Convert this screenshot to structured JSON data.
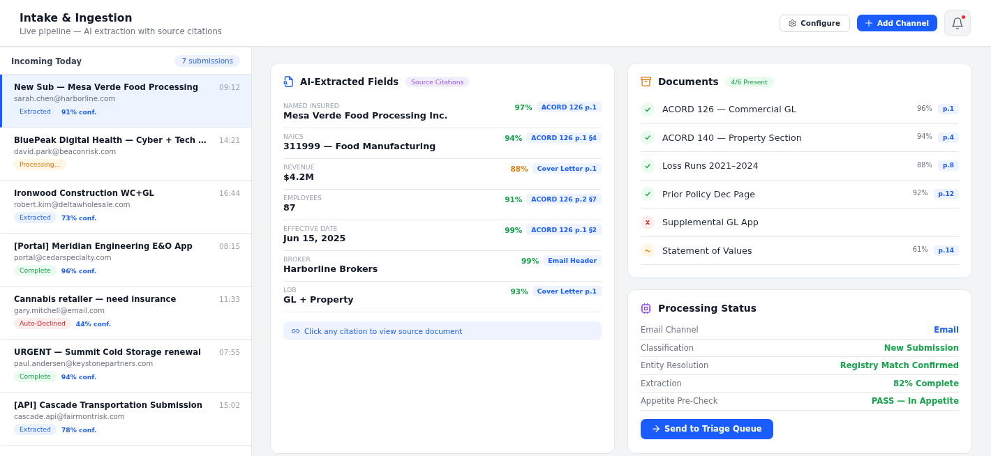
{
  "header": {
    "title": "Intake & Ingestion",
    "subtitle": "Live pipeline — AI extraction with source citations",
    "actions": [
      {
        "kind": "settings",
        "label": "Configure"
      },
      {
        "kind": "add",
        "label": "Add Channel"
      }
    ],
    "notifications": {
      "unread": true
    }
  },
  "inbox": {
    "title": "Incoming Today",
    "count": "7 submissions",
    "items": [
      {
        "title": "New Sub — Mesa Verde Food Processing",
        "time": "09:12",
        "email": "sarah.chen@harborline.com",
        "status": {
          "kind": "extracted",
          "label": "Extracted"
        },
        "confidence": "91% conf.",
        "selected": true
      },
      {
        "title": "BluePeak Digital Health — Cyber + Tech …",
        "time": "14:21",
        "email": "david.park@beaconrisk.com",
        "status": {
          "kind": "processing",
          "label": "Processing..."
        },
        "selected": false
      },
      {
        "title": "Ironwood Construction WC+GL",
        "time": "16:44",
        "email": "robert.kim@deltawholesale.com",
        "status": {
          "kind": "extracted",
          "label": "Extracted"
        },
        "confidence": "73% conf.",
        "selected": false
      },
      {
        "title": "[Portal] Meridian Engineering E&O App",
        "time": "08:15",
        "email": "portal@cedarspecialty.com",
        "status": {
          "kind": "complete",
          "label": "Complete"
        },
        "confidence": "96% conf.",
        "selected": false
      },
      {
        "title": "Cannabis retailer — need insurance",
        "time": "11:33",
        "email": "gary.mitchell@email.com",
        "status": {
          "kind": "declined",
          "label": "Auto-Declined"
        },
        "confidence": "44% conf.",
        "selected": false
      },
      {
        "title": "URGENT — Summit Cold Storage renewal",
        "time": "07:55",
        "email": "paul.andersen@keystonepartners.com",
        "status": {
          "kind": "complete",
          "label": "Complete"
        },
        "confidence": "94% conf.",
        "selected": false
      },
      {
        "title": "[API] Cascade Transportation Submission",
        "time": "15:02",
        "email": "cascade.api@fairmontrisk.com",
        "status": {
          "kind": "extracted",
          "label": "Extracted"
        },
        "confidence": "78% conf.",
        "selected": false
      }
    ]
  },
  "fields_card": {
    "title": "AI-Extracted Fields",
    "badge": "Source Citations",
    "fields": [
      {
        "label": "NAMED INSURED",
        "value": "Mesa Verde Food Processing Inc.",
        "confidence": "97%",
        "color": "#16a34a",
        "citation": "ACORD 126 p.1"
      },
      {
        "label": "NAICS",
        "value": "311999 — Food Manufacturing",
        "confidence": "94%",
        "color": "#16a34a",
        "citation": "ACORD 126 p.1 §4"
      },
      {
        "label": "REVENUE",
        "value": "$4.2M",
        "confidence": "88%",
        "color": "#e07a10",
        "citation": "Cover Letter p.1"
      },
      {
        "label": "EMPLOYEES",
        "value": "87",
        "confidence": "91%",
        "color": "#16a34a",
        "citation": "ACORD 126 p.2 §7"
      },
      {
        "label": "EFFECTIVE DATE",
        "value": "Jun 15, 2025",
        "confidence": "99%",
        "color": "#16a34a",
        "citation": "ACORD 126 p.1 §2"
      },
      {
        "label": "BROKER",
        "value": "Harborline Brokers",
        "confidence": "99%",
        "color": "#16a34a",
        "citation": "Email Header"
      },
      {
        "label": "LOB",
        "value": "GL + Property",
        "confidence": "93%",
        "color": "#16a34a",
        "citation": "Cover Letter p.1"
      }
    ],
    "hint": "Click any citation to view source document"
  },
  "documents_card": {
    "title": "Documents",
    "badge": "4/6 Present",
    "documents": [
      {
        "name": "ACORD 126 — Commercial GL",
        "kind": "present",
        "match": "96%",
        "page": "p.1"
      },
      {
        "name": "ACORD 140 — Property Section",
        "kind": "present",
        "match": "94%",
        "page": "p.4"
      },
      {
        "name": "Loss Runs 2021–2024",
        "kind": "present",
        "match": "88%",
        "page": "p.8"
      },
      {
        "name": "Prior Policy Dec Page",
        "kind": "present",
        "match": "92%",
        "page": "p.12"
      },
      {
        "name": "Supplemental GL App",
        "kind": "missing"
      },
      {
        "name": "Statement of Values",
        "kind": "partial",
        "match": "61%",
        "page": "p.14"
      }
    ]
  },
  "status_card": {
    "title": "Processing Status",
    "rows": [
      {
        "label": "Email Channel",
        "value": "Email",
        "color": "#1a5cff"
      },
      {
        "label": "Classification",
        "value": "New Submission",
        "color": "#16a34a"
      },
      {
        "label": "Entity Resolution",
        "value": "Registry Match Confirmed",
        "color": "#16a34a"
      },
      {
        "label": "Extraction",
        "value": "82% Complete",
        "color": "#16a34a"
      },
      {
        "label": "Appetite Pre-Check",
        "value": "PASS — In Appetite",
        "color": "#16a34a"
      }
    ],
    "action": "Send to Triage Queue"
  }
}
